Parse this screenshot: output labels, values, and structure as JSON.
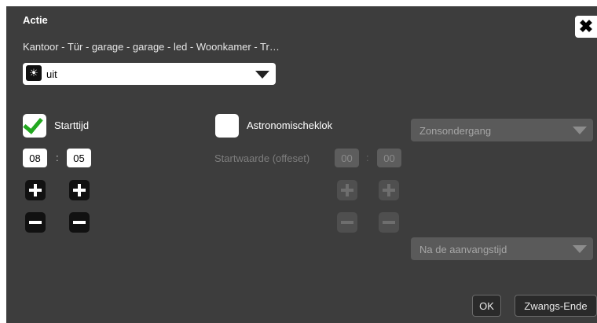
{
  "dialog": {
    "title": "Actie",
    "subtitle": "Kantoor - Tür - garage - garage - led - Woonkamer - Tr…",
    "close_icon": "✖"
  },
  "action_select": {
    "icon": "light-bulb-icon",
    "icon_glyph": "☀",
    "value": "uit"
  },
  "start_time": {
    "checked": true,
    "label": "Starttijd",
    "hours": "08",
    "minutes": "05",
    "separator": ":"
  },
  "astro": {
    "checked": false,
    "label": "Astronomischeklok",
    "offset_label": "Startwaarde (offeset)",
    "offset_hours": "00",
    "offset_minutes": "00",
    "separator": ":"
  },
  "dropdowns": {
    "event": "Zonsondergang",
    "relation": "Na de aanvangstijd"
  },
  "buttons": {
    "ok": "OK",
    "force_end": "Zwangs-Ende"
  },
  "colors": {
    "dialog_bg": "#3d3d3d",
    "check_green": "#22a81f"
  }
}
